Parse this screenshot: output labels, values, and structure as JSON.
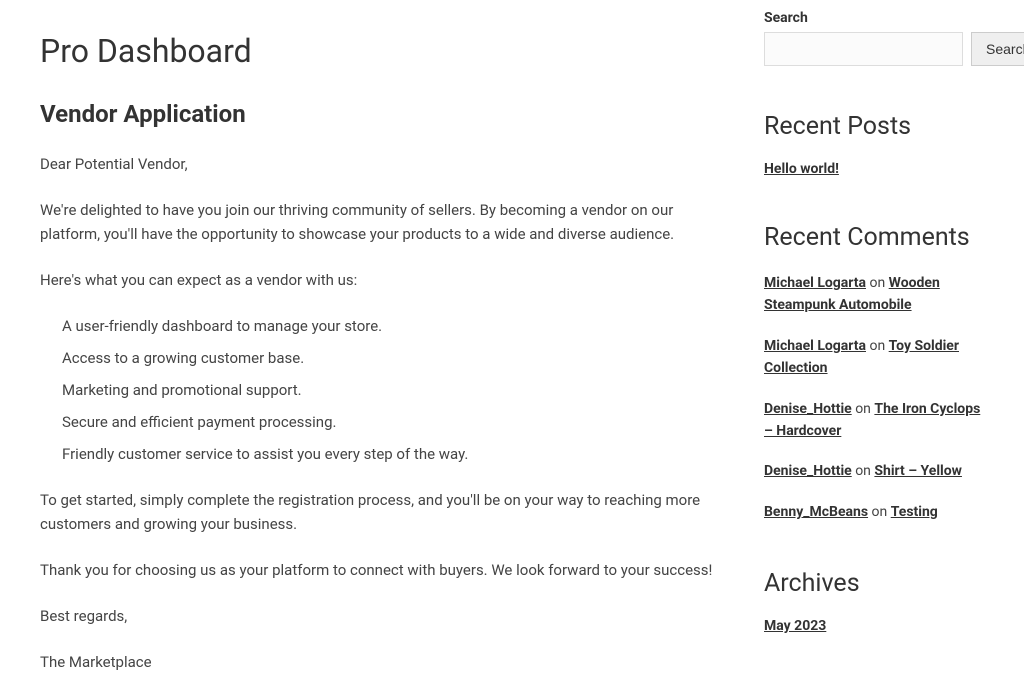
{
  "page": {
    "title": "Pro Dashboard"
  },
  "vendor": {
    "heading": "Vendor Application",
    "greeting": "Dear Potential Vendor,",
    "intro": "We're delighted to have you join our thriving community of sellers. By becoming a vendor on our platform, you'll have the opportunity to showcase your products to a wide and diverse audience.",
    "expect_lead": "Here's what you can expect as a vendor with us:",
    "benefits": [
      "A user-friendly dashboard to manage your store.",
      "Access to a growing customer base.",
      "Marketing and promotional support.",
      "Secure and efficient payment processing.",
      "Friendly customer service to assist you every step of the way."
    ],
    "get_started": "To get started, simply complete the registration process, and you'll be on your way to reaching more customers and growing your business.",
    "thanks": "Thank you for choosing us as your platform to connect with buyers. We look forward to your success!",
    "regards": "Best regards,",
    "signature": "The Marketplace"
  },
  "sidebar": {
    "search": {
      "label": "Search",
      "button": "Search"
    },
    "recent_posts": {
      "heading": "Recent Posts",
      "items": [
        "Hello world!"
      ]
    },
    "recent_comments": {
      "heading": "Recent Comments",
      "on_text": " on ",
      "items": [
        {
          "author": "Michael Logarta",
          "target": "Wooden Steampunk Automobile"
        },
        {
          "author": "Michael Logarta",
          "target": "Toy Soldier Collection"
        },
        {
          "author": "Denise_Hottie",
          "target": "The Iron Cyclops – Hardcover"
        },
        {
          "author": "Denise_Hottie",
          "target": "Shirt – Yellow"
        },
        {
          "author": "Benny_McBeans",
          "target": "Testing"
        }
      ]
    },
    "archives": {
      "heading": "Archives",
      "items": [
        "May 2023"
      ]
    }
  }
}
